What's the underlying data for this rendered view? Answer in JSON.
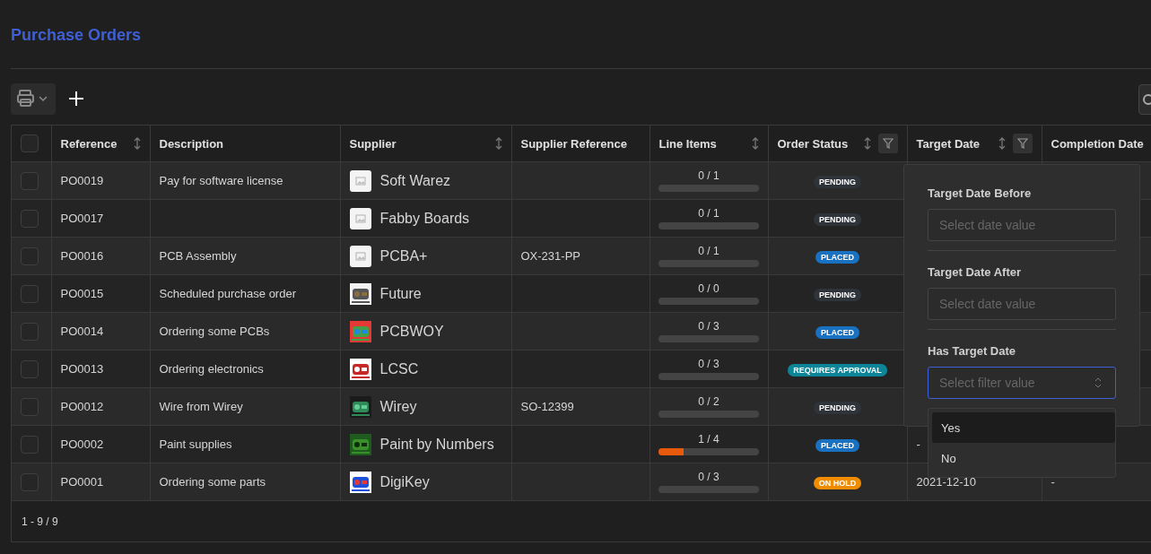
{
  "title": "Purchase Orders",
  "all_checked": false,
  "columns": [
    {
      "label": "Reference",
      "sortable": true
    },
    {
      "label": "Description"
    },
    {
      "label": "Supplier",
      "sortable": true
    },
    {
      "label": "Supplier Reference"
    },
    {
      "label": "Line Items",
      "sortable": true
    },
    {
      "label": "Order Status",
      "sortable": true,
      "filter": true
    },
    {
      "label": "Target Date",
      "sortable": true,
      "filter": true
    },
    {
      "label": "Completion Date"
    }
  ],
  "rows": [
    {
      "checked": false,
      "reference": "PO0019",
      "description": "Pay for software license",
      "supplier": {
        "name": "Soft Warez",
        "logo": {
          "kind": "placeholder"
        }
      },
      "line_items": {
        "text": "0 / 1",
        "level": 0
      },
      "status": {
        "label": "PENDING",
        "kind": "pending"
      }
    },
    {
      "checked": false,
      "reference": "PO0017",
      "supplier": {
        "name": "Fabby Boards",
        "logo": {
          "kind": "placeholder"
        }
      },
      "line_items": {
        "text": "0 / 1",
        "level": 0
      },
      "status": {
        "label": "PENDING",
        "kind": "pending"
      }
    },
    {
      "checked": false,
      "reference": "PO0016",
      "description": "PCB Assembly",
      "supplier": {
        "name": "PCBA+",
        "logo": {
          "kind": "placeholder"
        }
      },
      "supplier_reference": "OX-231-PP",
      "line_items": {
        "text": "0 / 1",
        "level": 0
      },
      "status": {
        "label": "PLACED",
        "kind": "placed"
      }
    },
    {
      "checked": false,
      "reference": "PO0015",
      "description": "Scheduled purchase order",
      "supplier": {
        "name": "Future"
      },
      "line_items": {
        "text": "0 / 0",
        "level": 0
      },
      "status": {
        "label": "PENDING",
        "kind": "pending"
      }
    },
    {
      "checked": false,
      "reference": "PO0014",
      "description": "Ordering some PCBs",
      "supplier": {
        "name": "PCBWOY"
      },
      "line_items": {
        "text": "0 / 3",
        "level": 0
      },
      "status": {
        "label": "PLACED",
        "kind": "placed"
      }
    },
    {
      "checked": false,
      "reference": "PO0013",
      "description": "Ordering electronics",
      "supplier": {
        "name": "LCSC"
      },
      "line_items": {
        "text": "0 / 3",
        "level": 0
      },
      "status": {
        "label": "REQUIRES APPROVAL",
        "kind": "approval"
      }
    },
    {
      "checked": false,
      "reference": "PO0012",
      "description": "Wire from Wirey",
      "supplier": {
        "name": "Wirey"
      },
      "supplier_reference": "SO-12399",
      "line_items": {
        "text": "0 / 2",
        "level": 0
      },
      "status": {
        "label": "PENDING",
        "kind": "pending"
      }
    },
    {
      "checked": false,
      "reference": "PO0002",
      "description": "Paint supplies",
      "supplier": {
        "name": "Paint by Numbers"
      },
      "line_items": {
        "text": "1 / 4",
        "level": 0.25
      },
      "status": {
        "label": "PLACED",
        "kind": "placed"
      },
      "target_date": "-"
    },
    {
      "checked": false,
      "reference": "PO0001",
      "description": "Ordering some parts",
      "supplier": {
        "name": "DigiKey"
      },
      "line_items": {
        "text": "0 / 3",
        "level": 0
      },
      "status": {
        "label": "ON HOLD",
        "kind": "hold"
      },
      "target_date": "2021-12-10",
      "completion_date": "-"
    }
  ],
  "pagination": "1 - 9 / 9",
  "filter_popover": {
    "sections": [
      {
        "label": "Target Date Before",
        "kind": "date",
        "placeholder": "Select date value",
        "focused": false
      },
      {
        "label": "Target Date After",
        "kind": "date",
        "placeholder": "Select date value",
        "focused": false
      },
      {
        "label": "Has Target Date",
        "kind": "select",
        "placeholder": "Select filter value",
        "focused": true
      }
    ],
    "options": [
      {
        "label": "Yes",
        "selected": true
      },
      {
        "label": "No",
        "selected": false
      }
    ]
  }
}
